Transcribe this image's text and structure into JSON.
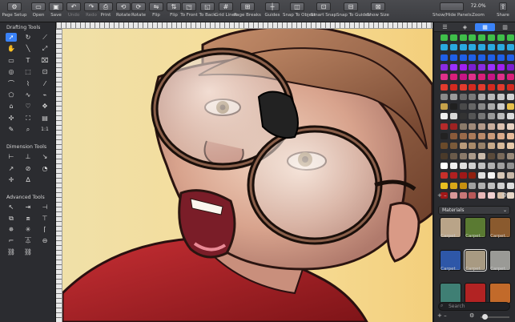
{
  "toolbar": {
    "items": [
      {
        "label": "Page Setup",
        "icon": "gear-icon",
        "glyph": "⚙"
      },
      {
        "label": "Open",
        "icon": "folder-icon",
        "glyph": "▭"
      },
      {
        "label": "Save",
        "icon": "floppy-icon",
        "glyph": "▣"
      },
      {
        "label": "Undo",
        "icon": "undo-icon",
        "glyph": "↶"
      },
      {
        "label": "Redo",
        "icon": "redo-icon",
        "glyph": "↷"
      },
      {
        "label": "Print",
        "icon": "printer-icon",
        "glyph": "⎙"
      },
      {
        "label": "Rotate",
        "icon": "rotate-left-icon",
        "glyph": "⟲"
      },
      {
        "label": "Rotate",
        "icon": "rotate-right-icon",
        "glyph": "⟳"
      },
      {
        "label": "Flip",
        "icon": "flip-horizontal-icon",
        "glyph": "⇋"
      },
      {
        "label": "Flip",
        "icon": "flip-vertical-icon",
        "glyph": "⇅"
      },
      {
        "label": "To Front",
        "icon": "bring-front-icon",
        "glyph": "◳"
      },
      {
        "label": "To Back",
        "icon": "send-back-icon",
        "glyph": "◱"
      },
      {
        "label": "Grid Lines",
        "icon": "grid-icon",
        "glyph": "#"
      },
      {
        "label": "Page Breaks",
        "icon": "page-breaks-icon",
        "glyph": "⊞"
      },
      {
        "label": "Guides",
        "icon": "guides-icon",
        "glyph": "┼"
      },
      {
        "label": "Snap To Object",
        "icon": "snap-object-icon",
        "glyph": "◫"
      },
      {
        "label": "Smart Snap",
        "icon": "smart-snap-icon",
        "glyph": "⊡"
      },
      {
        "label": "Snap To Guides",
        "icon": "snap-guides-icon",
        "glyph": "⊟"
      },
      {
        "label": "Show Size",
        "icon": "show-size-icon",
        "glyph": "⊠"
      }
    ],
    "show_hide_panels": "Show/Hide Panels",
    "zoom_label": "Zoom",
    "zoom_value": "72.0%",
    "share_label": "Share"
  },
  "left_panel": {
    "drafting_title": "Drafting Tools",
    "dimension_title": "Dimension Tools",
    "advanced_title": "Advanced Tools",
    "scale_label": "1:1"
  },
  "right_panel": {
    "tabs": [
      "sliders-icon",
      "layers-icon",
      "swatch-grid-icon",
      "chart-icon"
    ],
    "materials_label": "Materials",
    "materials": [
      {
        "label": "Carpet...",
        "color": "#b9a488"
      },
      {
        "label": "Carpet...",
        "color": "#5a7a32"
      },
      {
        "label": "Carpet...",
        "color": "#8a5a2e"
      },
      {
        "label": "Carpet...",
        "color": "#2e57a8"
      },
      {
        "label": "Carpet...",
        "color": "#a89a82"
      },
      {
        "label": "Carpet...",
        "color": "#9a9a96"
      },
      {
        "label": "",
        "color": "#3f7f74"
      },
      {
        "label": "",
        "color": "#b22323"
      },
      {
        "label": "",
        "color": "#c26a2a"
      }
    ],
    "search_placeholder": "Search"
  },
  "colors": {
    "accent": "#3a82f7",
    "canvas_bg": "#f6dc96",
    "shirt": "#b8222c"
  }
}
